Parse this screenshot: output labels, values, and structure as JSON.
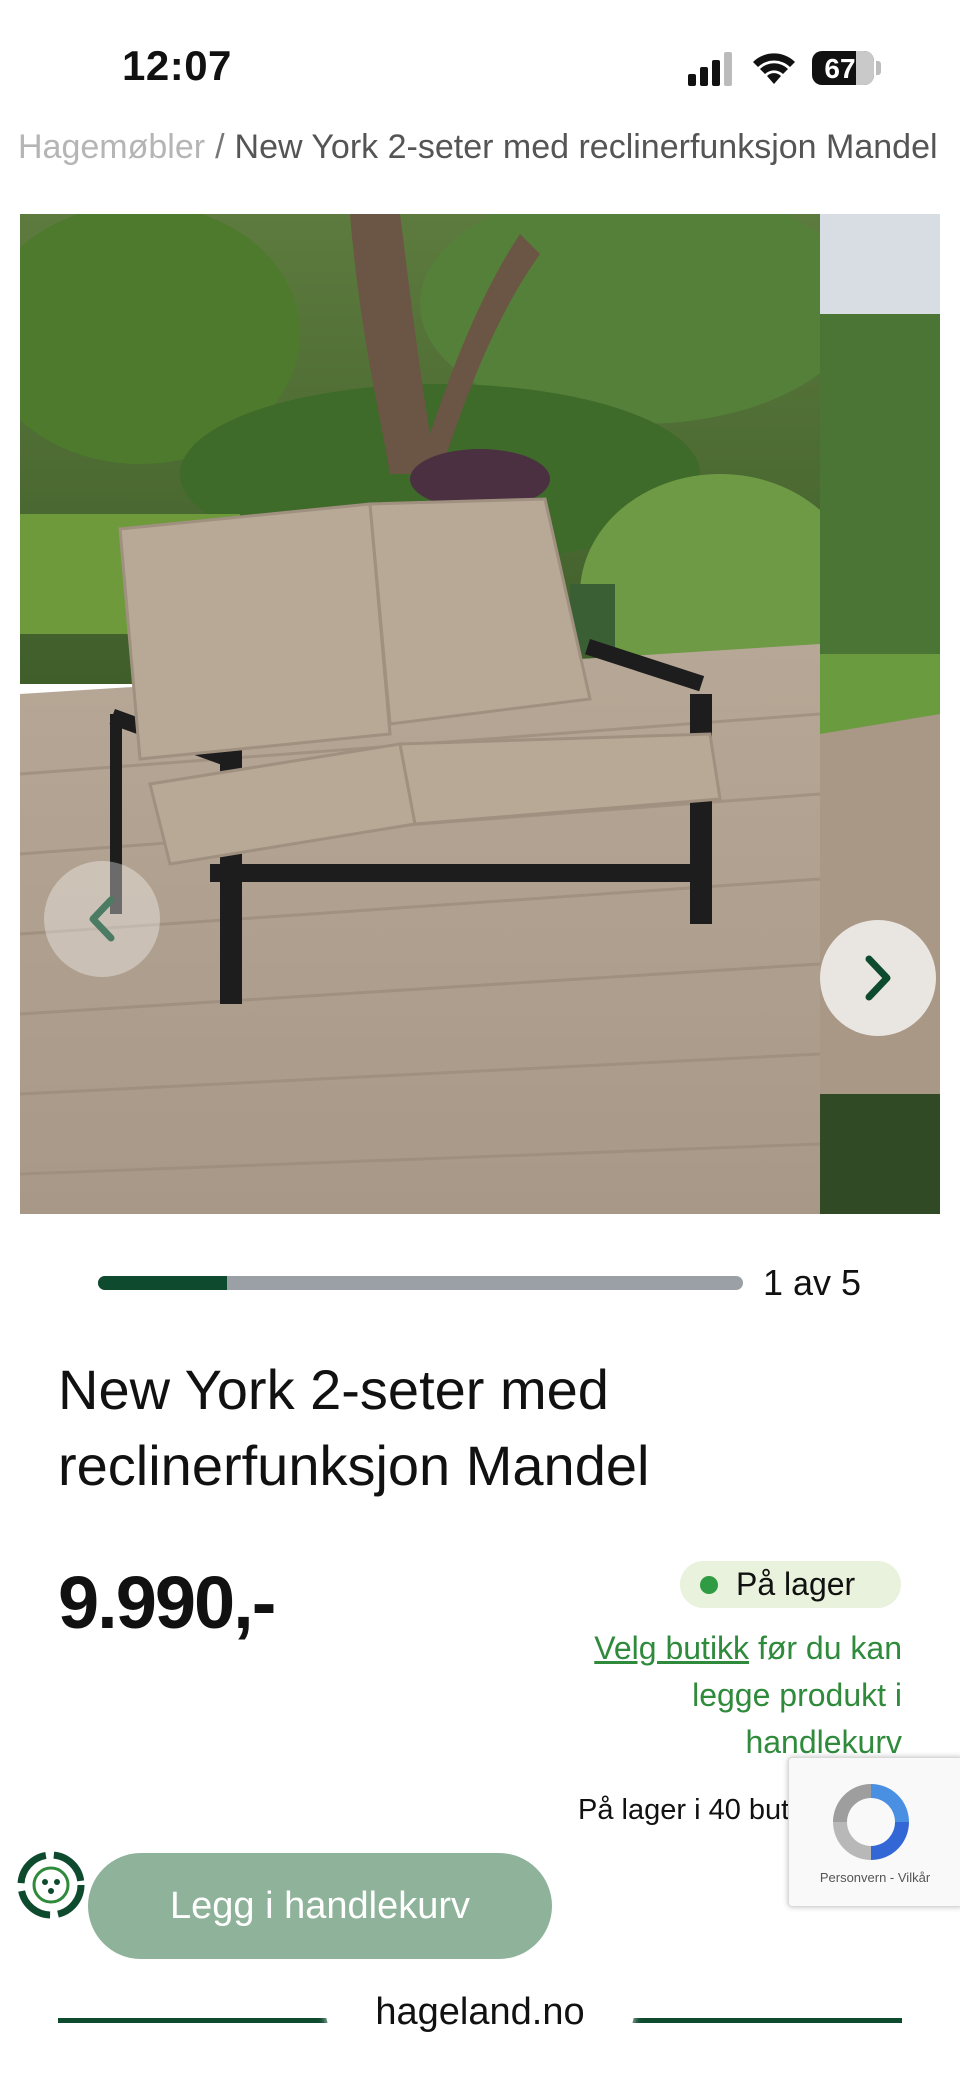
{
  "status_bar": {
    "time": "12:07",
    "battery": "67"
  },
  "breadcrumb": {
    "parent": "Hagemøbler",
    "separator": "/",
    "current": "New York 2-seter med reclinerfunksjon Mandel"
  },
  "gallery": {
    "current": 1,
    "total": 5,
    "counter_text": "1 av 5",
    "progress_fraction": 0.2
  },
  "product": {
    "title": "New York 2-seter med reclinerfunksjon Mandel",
    "price": "9.990,-",
    "stock_label": "På lager",
    "choose_store_link": "Velg butikk",
    "choose_store_rest": "før du kan legge produkt i handlekurv",
    "stock_count": "På lager i 40 butikker"
  },
  "recaptcha": {
    "links": "Personvern - Vilkår"
  },
  "cart": {
    "button_label": "Legg i handlekurv"
  },
  "browser": {
    "domain": "hageland.no"
  },
  "colors": {
    "brand_dark_green": "#0d4a2e",
    "link_green": "#2f8a3c",
    "cart_button": "#8fb39a",
    "stock_pill": "#e9f2dc"
  }
}
